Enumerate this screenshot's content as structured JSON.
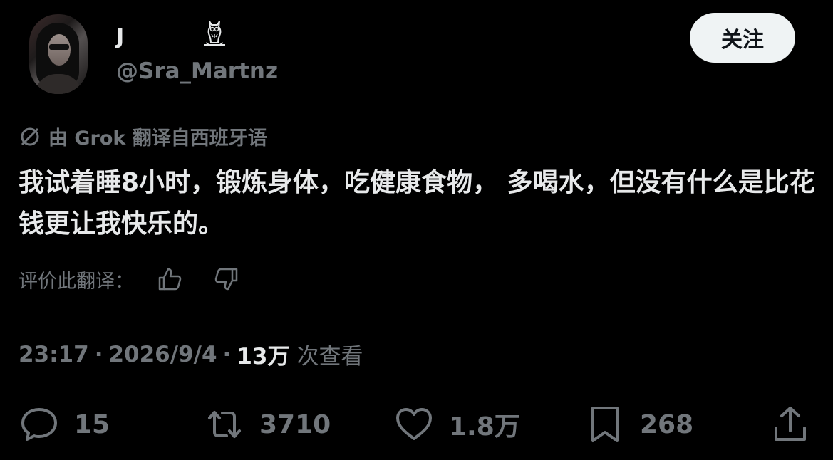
{
  "author": {
    "display_name": "J",
    "handle": "@Sra_Martnz",
    "badge_icon": "owl-icon",
    "avatar_icon": "avatar"
  },
  "follow_button": {
    "label": "关注"
  },
  "translation": {
    "icon": "translate-icon",
    "notice": "由 Grok 翻译自西班牙语"
  },
  "tweet": {
    "text": "我试着睡8小时，锻炼身体，吃健康食物， 多喝水，但没有什么是比花钱更让我快乐的。"
  },
  "rate_translation": {
    "label": "评价此翻译：",
    "thumbs_up_icon": "thumbs-up-icon",
    "thumbs_down_icon": "thumbs-down-icon"
  },
  "meta": {
    "time": "23:17",
    "separator": "·",
    "date": "2026/9/4",
    "views_count": "13万",
    "views_label": "次查看"
  },
  "actions": {
    "reply_count": "15",
    "retweet_count": "3710",
    "like_count": "1.8万",
    "bookmark_count": "268",
    "reply_icon": "reply-icon",
    "retweet_icon": "retweet-icon",
    "like_icon": "heart-icon",
    "bookmark_icon": "bookmark-icon",
    "share_icon": "share-icon"
  },
  "colors": {
    "background": "#000000",
    "primary_text": "#e7e9ea",
    "secondary_text": "#71767b",
    "follow_button_bg": "#eff3f4"
  }
}
